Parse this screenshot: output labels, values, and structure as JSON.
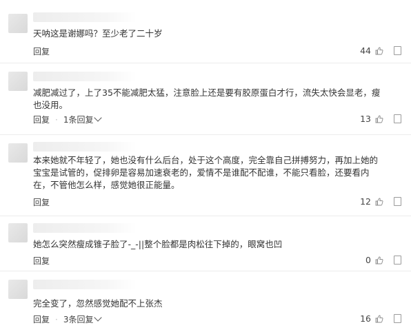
{
  "comments": [
    {
      "text": "天呐这是谢娜吗？至少老了二十岁",
      "reply_label": "回复",
      "replies_label": "",
      "likes": "44"
    },
    {
      "text": "减肥减过了，上了35不能减肥太猛，注意脸上还是要有胶原蛋白才行，流失太快会显老，瘦也没用。",
      "reply_label": "回复",
      "replies_label": "1条回复",
      "likes": "13"
    },
    {
      "text": "本来她就不年轻了，她也没有什么后台，处于这个高度，完全靠自己拼搏努力，再加上她的宝宝是试管的，促排卵是容易加速衰老的，爱情不是谁配不配谁，不能只看脸，还要看内在，不管他怎么样，感觉她很正能量。",
      "reply_label": "回复",
      "replies_label": "",
      "likes": "12"
    },
    {
      "text": "她怎么突然瘦成锥子脸了-_-||整个脸都是肉松往下掉的，眼窝也凹",
      "reply_label": "回复",
      "replies_label": "",
      "likes": "0"
    },
    {
      "text": "完全变了，忽然感觉她配不上张杰",
      "reply_label": "回复",
      "replies_label": "3条回复",
      "likes": "16"
    }
  ],
  "colors": {
    "text": "#333333",
    "divider": "#ececec",
    "icon": "#9a9a9a"
  }
}
